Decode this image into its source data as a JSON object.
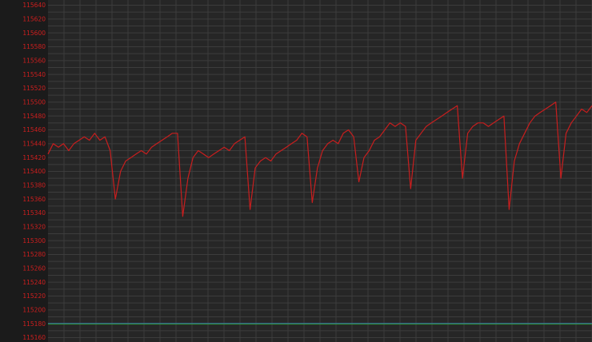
{
  "chart_data": {
    "type": "line",
    "title": "",
    "xlabel": "",
    "ylabel": "",
    "ylim": [
      115160,
      115640
    ],
    "yticks": [
      115640,
      115620,
      115600,
      115580,
      115560,
      115540,
      115520,
      115500,
      115480,
      115460,
      115440,
      115420,
      115400,
      115380,
      115360,
      115340,
      115320,
      115300,
      115280,
      115260,
      115240,
      115220,
      115200,
      115180,
      115160
    ],
    "x_count": 100,
    "grid": true,
    "series": [
      {
        "color": "#c81e1e",
        "values": [
          115425,
          115440,
          115435,
          115440,
          115430,
          115440,
          115445,
          115450,
          115445,
          115455,
          115445,
          115450,
          115430,
          115360,
          115400,
          115415,
          115420,
          115425,
          115430,
          115425,
          115435,
          115440,
          115445,
          115450,
          115455,
          115455,
          115335,
          115390,
          115420,
          115430,
          115425,
          115420,
          115425,
          115430,
          115435,
          115430,
          115440,
          115445,
          115450,
          115345,
          115405,
          115415,
          115420,
          115415,
          115425,
          115430,
          115435,
          115440,
          115445,
          115455,
          115450,
          115355,
          115405,
          115430,
          115440,
          115445,
          115440,
          115455,
          115460,
          115450,
          115385,
          115420,
          115430,
          115445,
          115450,
          115460,
          115470,
          115465,
          115470,
          115465,
          115375,
          115445,
          115455,
          115465,
          115470,
          115475,
          115480,
          115485,
          115490,
          115495,
          115390,
          115455,
          115465,
          115470,
          115470,
          115465,
          115470,
          115475,
          115480,
          115345,
          115415,
          115440,
          115455,
          115470,
          115480,
          115485,
          115490,
          115495,
          115500,
          115390,
          115455,
          115470,
          115480,
          115490,
          115485,
          115495
        ]
      },
      {
        "color": "#2f8f3f",
        "values": [
          115180
        ]
      }
    ]
  },
  "colors": {
    "background": "#1b1b1b",
    "plot_background": "#262626",
    "grid": "#3c3c3c",
    "tick_label": "#d01e1e",
    "baseline": "#2f8f3f",
    "baseline_top": "#3a6fb0"
  }
}
